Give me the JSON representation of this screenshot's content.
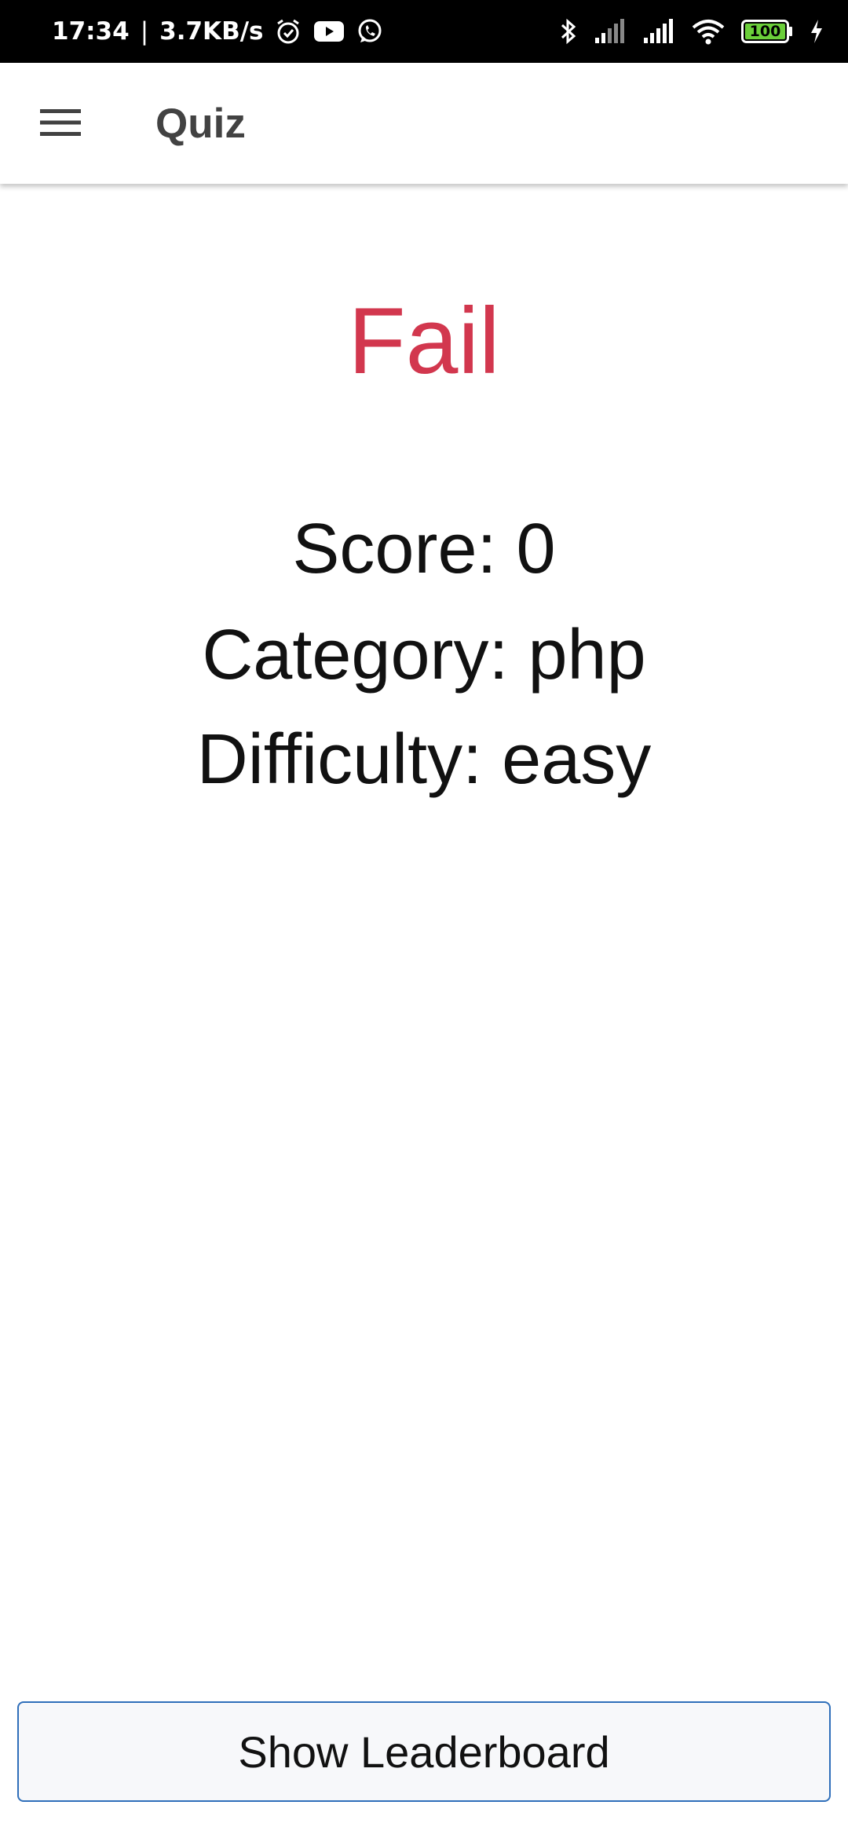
{
  "status_bar": {
    "time": "17:34",
    "network_speed": "3.7KB/s",
    "battery_level": "100",
    "icons": [
      "alarm-icon",
      "youtube-icon",
      "whatsapp-icon",
      "bluetooth-icon",
      "signal-icon",
      "wifi-icon",
      "battery-icon",
      "charging-icon"
    ]
  },
  "app_bar": {
    "title": "Quiz",
    "menu_icon": "hamburger-menu-icon"
  },
  "result": {
    "status": "Fail",
    "status_color": "#d2374e",
    "score_line": "Score: 0",
    "category_line": "Category: php",
    "difficulty_line": "Difficulty: easy"
  },
  "actions": {
    "leaderboard_label": "Show Leaderboard",
    "border_color": "#2f6fba"
  }
}
